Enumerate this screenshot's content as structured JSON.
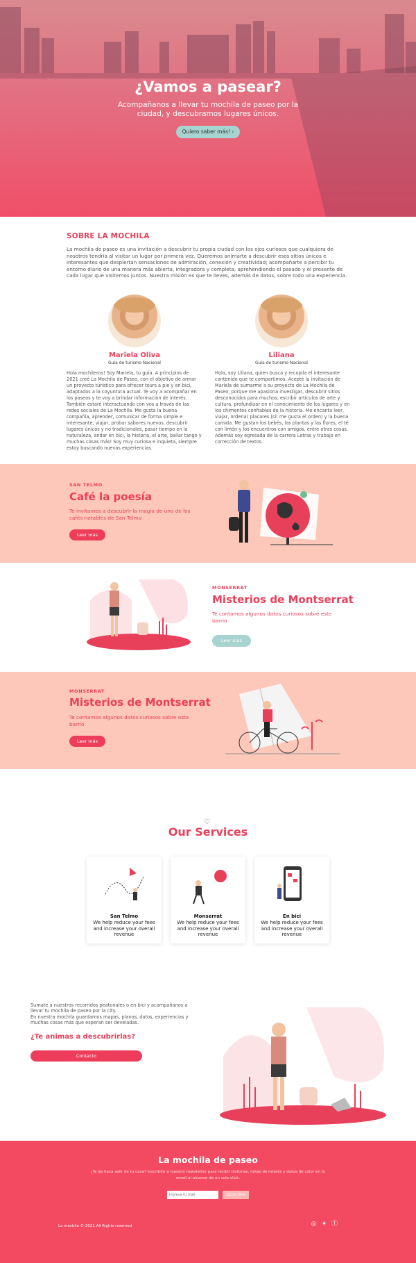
{
  "hero": {
    "title": "¿Vamos a pasear?",
    "subtitle": "Acompañanos a llevar tu mochila de paseo por la ciudad, y descubramos lugares únicos.",
    "button": "Quiero saber más!",
    "button_icon": "chevron-right-icon"
  },
  "about": {
    "title": "SOBRE LA MOCHILA",
    "text": "La mochila de paseo es una invitación a descubrir tu propia ciudad con los ojos curiosos que cualquiera de nosotros tendría al visitar un lugar por primera vez. Queremos animarte a descubrir esos sitios únicos e interesantes que despiertan sensaciones de admiración, conexión y creatividad; acompañarte a percibir tu entorno diario de una manera más abierta, integradora y completa, aprehendiendo el pasado y el presente de cada lugar que visitemos juntos. Nuestra misión es que te lleves, además de datos, sobre todo una experiencia.",
    "people": [
      {
        "name": "Mariela Oliva",
        "role": "Guía de turismo Nacional",
        "bio": "Hola mochileros! Soy Mariela, tu guía. A principios de 2021 creé La Mochila de Paseo, con el objetivo de armar un proyecto turístico para ofrecer tours a pie y en bici, adaptados a la coyuntura actual. Te voy a acompañar en los paseos y te voy a brindar información de interés. También estaré interactuando con vos a través de las redes sociales de La Mochila. Me gusta la buena compañía, aprender, comunicar de forma simple e interesante, viajar, probar sabores nuevos, descubrir lugares únicos y no tradicionales, pasar tiempo en la naturaleza, andar en bici, la historia, el arte, bailar tango y muchas cosas más! Soy muy curiosa e inquieta, siempre estoy buscando nuevas experiencias."
      },
      {
        "name": "Liliana",
        "role": "Guía de turismo Nacional",
        "bio": "Hola, soy Liliana, quien busca y recopila el interesante contenido que te compartimos. Acepté la invitación de Mariela de sumarme a su proyecto de La Mochila de Paseo, porque me apasiona investigar, descubrir sitios desconocidos para muchos, escribir artículos de arte y cultura, profundizar en el conocimiento de los lugares y en los chimentos confiables de la historia. Me encanta leer, viajar, ordenar placares (sí! me gusta el orden) y la buena comida. Me gustan los bebés, las plantas y las flores, el té con limón y los encuentros con amigos, entre otras cosas. Además soy egresada de la carrera Letras y trabajo en corrección de textos."
      }
    ]
  },
  "features": [
    {
      "kicker": "SAN TELMO",
      "title": "Café la poesía",
      "desc": "Te invitamos a descubrir la magia de uno de los cafés notables de San Telmo",
      "button": "Leer más"
    },
    {
      "kicker": "MONSERRAT",
      "title": "Misterios de Montserrat",
      "desc": "Te contamos algunos datos curiosos sobre este barrio",
      "button": "Leer más"
    },
    {
      "kicker": "MONSERRAT",
      "title": "Misterios de Montserrat",
      "desc": "Te contamos algunos datos curiosos sobre este barrio",
      "button": "Leer más"
    }
  ],
  "services": {
    "icon": "heart-icon",
    "title": "Our Services",
    "cards": [
      {
        "title": "San Telmo",
        "desc": "We help reduce your fees and increase your overall revenue"
      },
      {
        "title": "Monserrat",
        "desc": "We help reduce your fees and increase your overall revenue"
      },
      {
        "title": "En bici",
        "desc": "We help reduce your fees and increase your overall revenue"
      }
    ]
  },
  "cta": {
    "text1": "Sumate a nuestros recorridos peatonales o en bici y acompañanos a llevar tu mochila de paseo por la city.",
    "text2": "En nuestra mochila guardamos mapas, planos, datos, experiencias y muchas cosas más que esperan ser develadas.",
    "title": "¿Te animas a descubrirlas?",
    "button": "Contacto"
  },
  "footer": {
    "title": "La mochila de paseo",
    "text": "¿Te da fiaca salir de tu casa? Inscribite a nuestro newsletter para recibir historias, notas de interés y datos de color en tu email al alcance de un solo click.",
    "input_placeholder": "Ingresa tu mail",
    "subscribe": "Subscribe",
    "copyright": "La mochila © 2021 All Rights reserved",
    "social": [
      "instagram-icon",
      "twitter-icon",
      "facebook-icon"
    ]
  },
  "colors": {
    "accent": "#e8405a",
    "band": "#fdc7ba",
    "teal": "#a7d3d0",
    "footer": "#f34a62"
  }
}
